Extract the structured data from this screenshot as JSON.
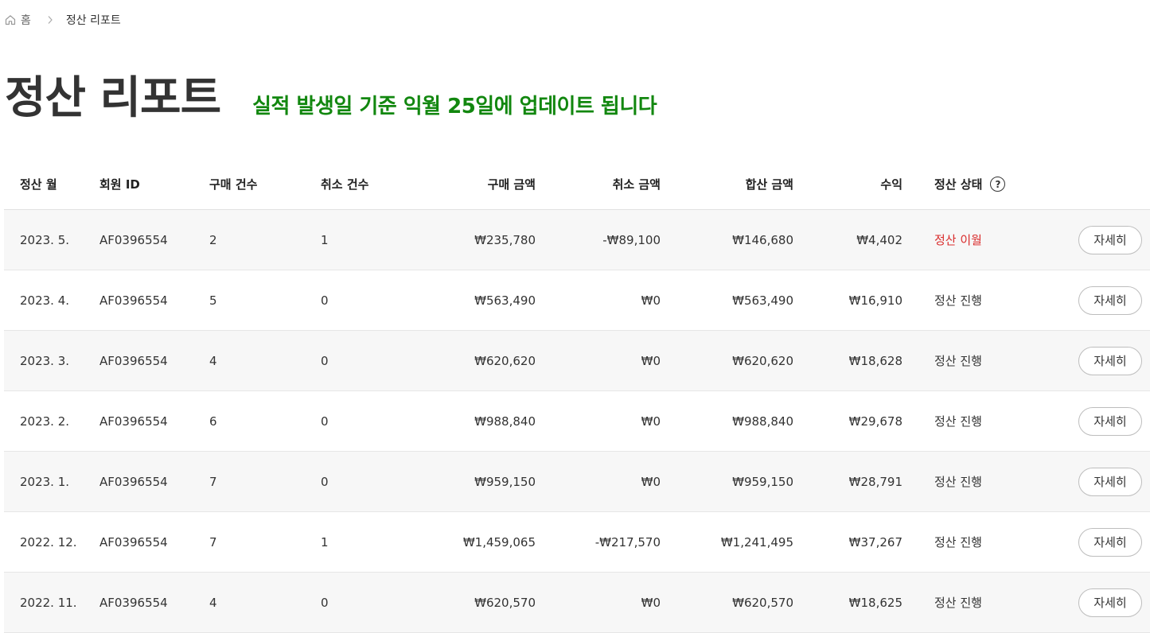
{
  "breadcrumb": {
    "home_label": "홈",
    "current_label": "정산 리포트"
  },
  "header": {
    "title": "정산 리포트",
    "subtitle": "실적 발생일 기준 익월 25일에 업데이트 됩니다"
  },
  "table": {
    "columns": {
      "month": "정산 월",
      "member_id": "회원 ID",
      "buy_count": "구매 건수",
      "cancel_count": "취소 건수",
      "buy_amount": "구매 금액",
      "cancel_amount": "취소 금액",
      "total_amount": "합산 금액",
      "profit": "수익",
      "status": "정산 상태"
    },
    "help_icon_glyph": "?",
    "detail_label": "자세히",
    "status_alert_color": "#d92c2c",
    "rows": [
      {
        "month": "2023. 5.",
        "member_id": "AF0396554",
        "buy_count": "2",
        "cancel_count": "1",
        "buy_amount": "₩235,780",
        "cancel_amount": "-₩89,100",
        "total_amount": "₩146,680",
        "profit": "₩4,402",
        "status": "정산 이월"
      },
      {
        "month": "2023. 4.",
        "member_id": "AF0396554",
        "buy_count": "5",
        "cancel_count": "0",
        "buy_amount": "₩563,490",
        "cancel_amount": "₩0",
        "total_amount": "₩563,490",
        "profit": "₩16,910",
        "status": "정산 진행"
      },
      {
        "month": "2023. 3.",
        "member_id": "AF0396554",
        "buy_count": "4",
        "cancel_count": "0",
        "buy_amount": "₩620,620",
        "cancel_amount": "₩0",
        "total_amount": "₩620,620",
        "profit": "₩18,628",
        "status": "정산 진행"
      },
      {
        "month": "2023. 2.",
        "member_id": "AF0396554",
        "buy_count": "6",
        "cancel_count": "0",
        "buy_amount": "₩988,840",
        "cancel_amount": "₩0",
        "total_amount": "₩988,840",
        "profit": "₩29,678",
        "status": "정산 진행"
      },
      {
        "month": "2023. 1.",
        "member_id": "AF0396554",
        "buy_count": "7",
        "cancel_count": "0",
        "buy_amount": "₩959,150",
        "cancel_amount": "₩0",
        "total_amount": "₩959,150",
        "profit": "₩28,791",
        "status": "정산 진행"
      },
      {
        "month": "2022. 12.",
        "member_id": "AF0396554",
        "buy_count": "7",
        "cancel_count": "1",
        "buy_amount": "₩1,459,065",
        "cancel_amount": "-₩217,570",
        "total_amount": "₩1,241,495",
        "profit": "₩37,267",
        "status": "정산 진행"
      },
      {
        "month": "2022. 11.",
        "member_id": "AF0396554",
        "buy_count": "4",
        "cancel_count": "0",
        "buy_amount": "₩620,570",
        "cancel_amount": "₩0",
        "total_amount": "₩620,570",
        "profit": "₩18,625",
        "status": "정산 진행"
      }
    ]
  }
}
